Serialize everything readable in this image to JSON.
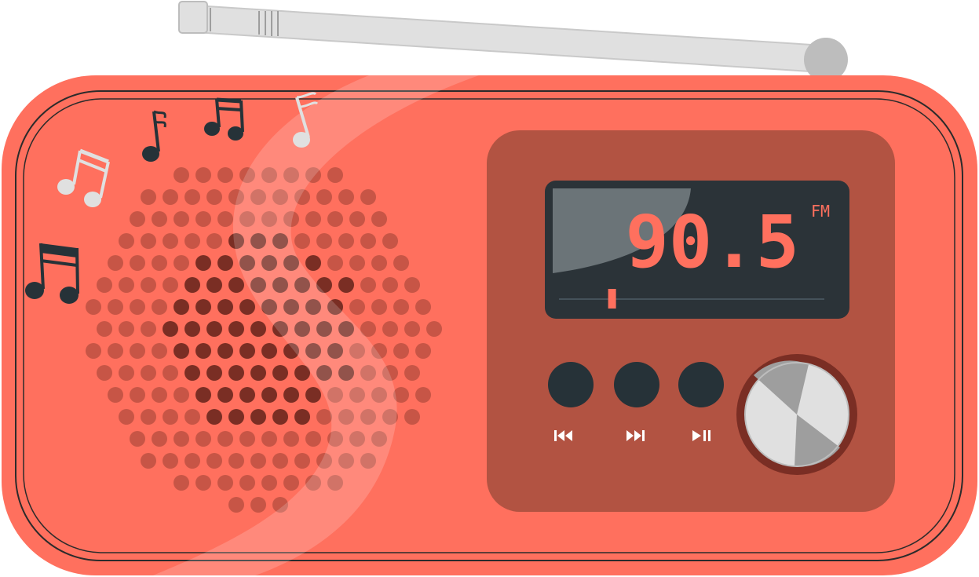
{
  "display": {
    "frequency": "90.5",
    "band": "FM",
    "tuning_level": 0.2
  },
  "controls": {
    "buttons": [
      {
        "icon": "skip-previous-icon"
      },
      {
        "icon": "skip-next-icon"
      },
      {
        "icon": "play-pause-icon"
      }
    ],
    "knob": {
      "icon": "volume-knob"
    }
  },
  "colors": {
    "body": "#FF705E",
    "body_outline": "#2B2B2B",
    "panel": "#B25342",
    "lcd": "#2B3338",
    "lcd_glare": "#6B7478",
    "digits": "#FF705E",
    "speaker_outer": "#C75546",
    "speaker_inner": "#7A2E24",
    "antenna": "#DCDCDC",
    "knob_ring": "#7A2E24",
    "notes_dark": "#263238",
    "notes_light": "#E0E0E0"
  }
}
